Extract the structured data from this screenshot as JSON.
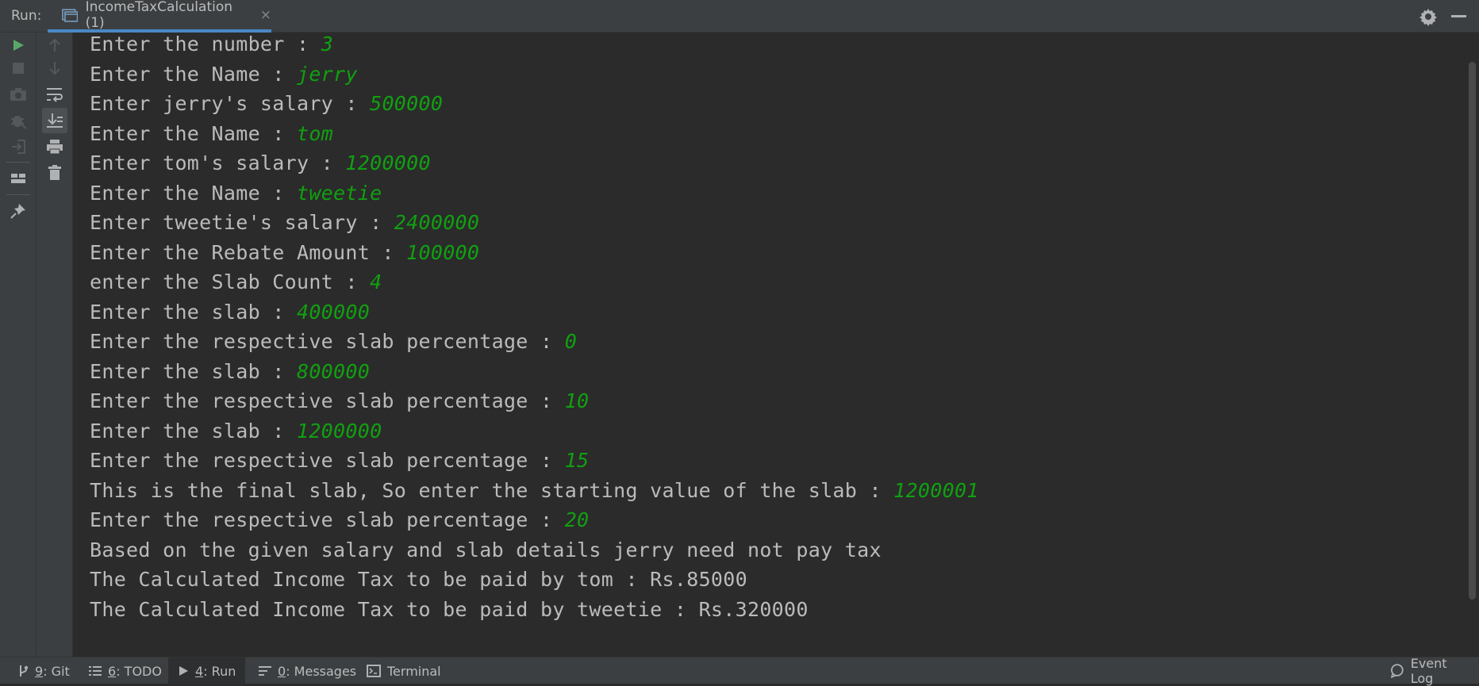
{
  "topbar": {
    "run_label": "Run:",
    "tab_title": "IncomeTaxCalculation (1)",
    "tab_close": "×"
  },
  "console_lines": [
    {
      "prompt": "Enter the number : ",
      "input": "3"
    },
    {
      "prompt": "Enter the Name : ",
      "input": "jerry"
    },
    {
      "prompt": "Enter jerry's salary : ",
      "input": "500000"
    },
    {
      "prompt": "Enter the Name : ",
      "input": "tom"
    },
    {
      "prompt": "Enter tom's salary : ",
      "input": "1200000"
    },
    {
      "prompt": "Enter the Name : ",
      "input": "tweetie"
    },
    {
      "prompt": "Enter tweetie's salary : ",
      "input": "2400000"
    },
    {
      "prompt": "Enter the Rebate Amount : ",
      "input": "100000"
    },
    {
      "prompt": "enter the Slab Count : ",
      "input": "4"
    },
    {
      "prompt": "Enter the slab : ",
      "input": "400000"
    },
    {
      "prompt": "Enter the respective slab percentage : ",
      "input": "0"
    },
    {
      "prompt": "Enter the slab : ",
      "input": "800000"
    },
    {
      "prompt": "Enter the respective slab percentage : ",
      "input": "10"
    },
    {
      "prompt": "Enter the slab : ",
      "input": "1200000"
    },
    {
      "prompt": "Enter the respective slab percentage : ",
      "input": "15"
    },
    {
      "prompt": "This is the final slab, So enter the starting value of the slab : ",
      "input": "1200001"
    },
    {
      "prompt": "Enter the respective slab percentage : ",
      "input": "20"
    },
    {
      "prompt": "Based on the given salary and slab details jerry need not pay tax",
      "input": ""
    },
    {
      "prompt": "The Calculated Income Tax to be paid by tom : Rs.85000",
      "input": ""
    },
    {
      "prompt": "The Calculated Income Tax to be paid by tweetie : Rs.320000",
      "input": ""
    }
  ],
  "bottombar": {
    "git_num": "9",
    "git_label": ": Git",
    "todo_num": "6",
    "todo_label": ": TODO",
    "run_num": "4",
    "run_label": ": Run",
    "messages_num": "0",
    "messages_label": ": Messages",
    "terminal_label": "Terminal",
    "event_log_label": "Event Log"
  },
  "colors": {
    "background": "#2b2b2b",
    "panel": "#3c3f41",
    "output_text": "#bbbbbb",
    "user_input": "#10a010",
    "run_green": "#59a869",
    "tab_underline": "#4a88c7"
  }
}
